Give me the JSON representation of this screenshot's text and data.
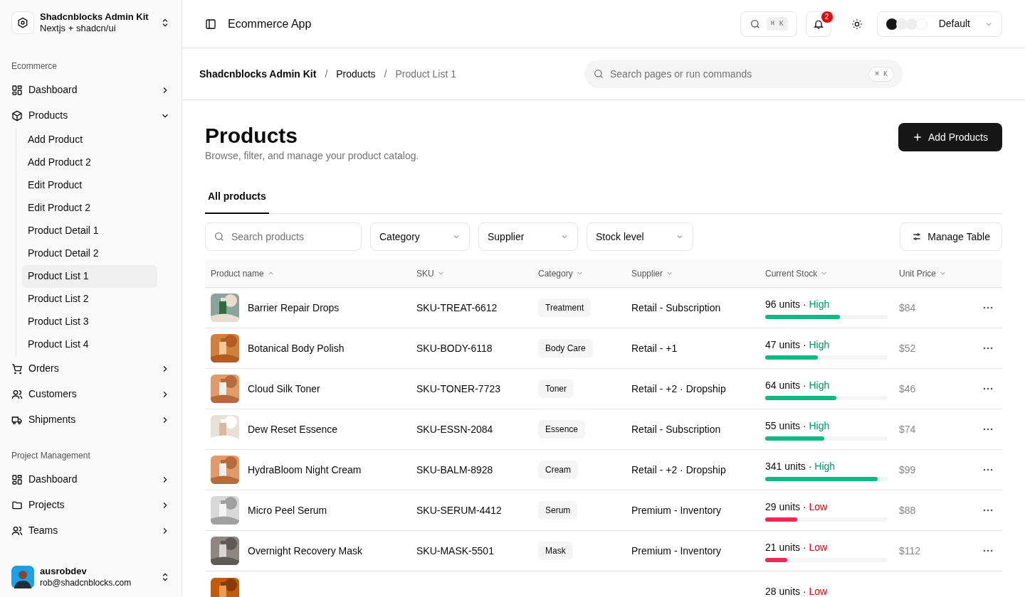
{
  "workspace": {
    "name": "Shadcnblocks Admin Kit",
    "subtitle": "Nextjs + shadcn/ui"
  },
  "sidebar": {
    "sections": [
      {
        "title": "Ecommerce",
        "items": [
          {
            "label": "Dashboard",
            "expanded": false
          },
          {
            "label": "Products",
            "expanded": true,
            "children": [
              {
                "label": "Add Product",
                "selected": false
              },
              {
                "label": "Add Product 2",
                "selected": false
              },
              {
                "label": "Edit Product",
                "selected": false
              },
              {
                "label": "Edit Product 2",
                "selected": false
              },
              {
                "label": "Product Detail 1",
                "selected": false
              },
              {
                "label": "Product Detail 2",
                "selected": false
              },
              {
                "label": "Product List 1",
                "selected": true
              },
              {
                "label": "Product List 2",
                "selected": false
              },
              {
                "label": "Product List 3",
                "selected": false
              },
              {
                "label": "Product List 4",
                "selected": false
              }
            ]
          },
          {
            "label": "Orders",
            "expanded": false
          },
          {
            "label": "Customers",
            "expanded": false
          },
          {
            "label": "Shipments",
            "expanded": false
          }
        ]
      },
      {
        "title": "Project Management",
        "items": [
          {
            "label": "Dashboard",
            "expanded": false
          },
          {
            "label": "Projects",
            "expanded": false
          },
          {
            "label": "Teams",
            "expanded": false
          }
        ]
      }
    ]
  },
  "user": {
    "name": "ausrobdev",
    "email": "rob@shadcnblocks.com"
  },
  "header": {
    "title": "Ecommerce App",
    "search_shortcut": "⌘ K",
    "notifications": "2",
    "theme": "Default"
  },
  "breadcrumb_separator": "/",
  "breadcrumb": [
    {
      "label": "Shadcnblocks Admin Kit",
      "current": false
    },
    {
      "label": "Products",
      "current": false
    },
    {
      "label": "Product List 1",
      "current": true
    }
  ],
  "command_search": {
    "placeholder": "Search pages or run commands",
    "shortcut": "⌘ K"
  },
  "page": {
    "title": "Products",
    "subtitle": "Browse, filter, and manage your product catalog.",
    "primary_button": "Add Products"
  },
  "tabs": [
    {
      "label": "All products",
      "selected": true
    }
  ],
  "filters": {
    "search_placeholder": "Search products",
    "dropdowns": [
      "Category",
      "Supplier",
      "Stock level"
    ],
    "manage_button": "Manage Table"
  },
  "table": {
    "columns": [
      {
        "label": "Product name",
        "sorted": true
      },
      {
        "label": "SKU",
        "sorted": false
      },
      {
        "label": "Category",
        "sorted": false
      },
      {
        "label": "Supplier",
        "sorted": false
      },
      {
        "label": "Current Stock",
        "sorted": false
      },
      {
        "label": "Unit Price",
        "sorted": false
      }
    ],
    "stock_separator": "·",
    "rows": [
      {
        "name": "Barrier Repair Drops",
        "sku": "SKU-TREAT-6612",
        "category": "Treatment",
        "supplier": "Retail - Subscription",
        "stock": "96 units",
        "status": "High",
        "low_stock": false,
        "level": 0.61,
        "price": "$84"
      },
      {
        "name": "Botanical Body Polish",
        "sku": "SKU-BODY-6118",
        "category": "Body Care",
        "supplier": "Retail - +1",
        "stock": "47 units",
        "status": "High",
        "low_stock": false,
        "level": 0.43,
        "price": "$52"
      },
      {
        "name": "Cloud Silk Toner",
        "sku": "SKU-TONER-7723",
        "category": "Toner",
        "supplier": "Retail - +2 · Dropship",
        "stock": "64 units",
        "status": "High",
        "low_stock": false,
        "level": 0.58,
        "price": "$46"
      },
      {
        "name": "Dew Reset Essence",
        "sku": "SKU-ESSN-2084",
        "category": "Essence",
        "supplier": "Retail - Subscription",
        "stock": "55 units",
        "status": "High",
        "low_stock": false,
        "level": 0.48,
        "price": "$74"
      },
      {
        "name": "HydraBloom Night Cream",
        "sku": "SKU-BALM-8928",
        "category": "Cream",
        "supplier": "Retail - +2 · Dropship",
        "stock": "341 units",
        "status": "High",
        "low_stock": false,
        "level": 0.92,
        "price": "$99"
      },
      {
        "name": "Micro Peel Serum",
        "sku": "SKU-SERUM-4412",
        "category": "Serum",
        "supplier": "Premium - Inventory",
        "stock": "29 units",
        "status": "Low",
        "low_stock": true,
        "level": 0.26,
        "price": "$88"
      },
      {
        "name": "Overnight Recovery Mask",
        "sku": "SKU-MASK-5501",
        "category": "Mask",
        "supplier": "Premium - Inventory",
        "stock": "21 units",
        "status": "Low",
        "low_stock": true,
        "level": 0.18,
        "price": "$112"
      }
    ],
    "partial_row": {
      "stock": "28 units",
      "status": "Low",
      "low_stock": true
    }
  }
}
